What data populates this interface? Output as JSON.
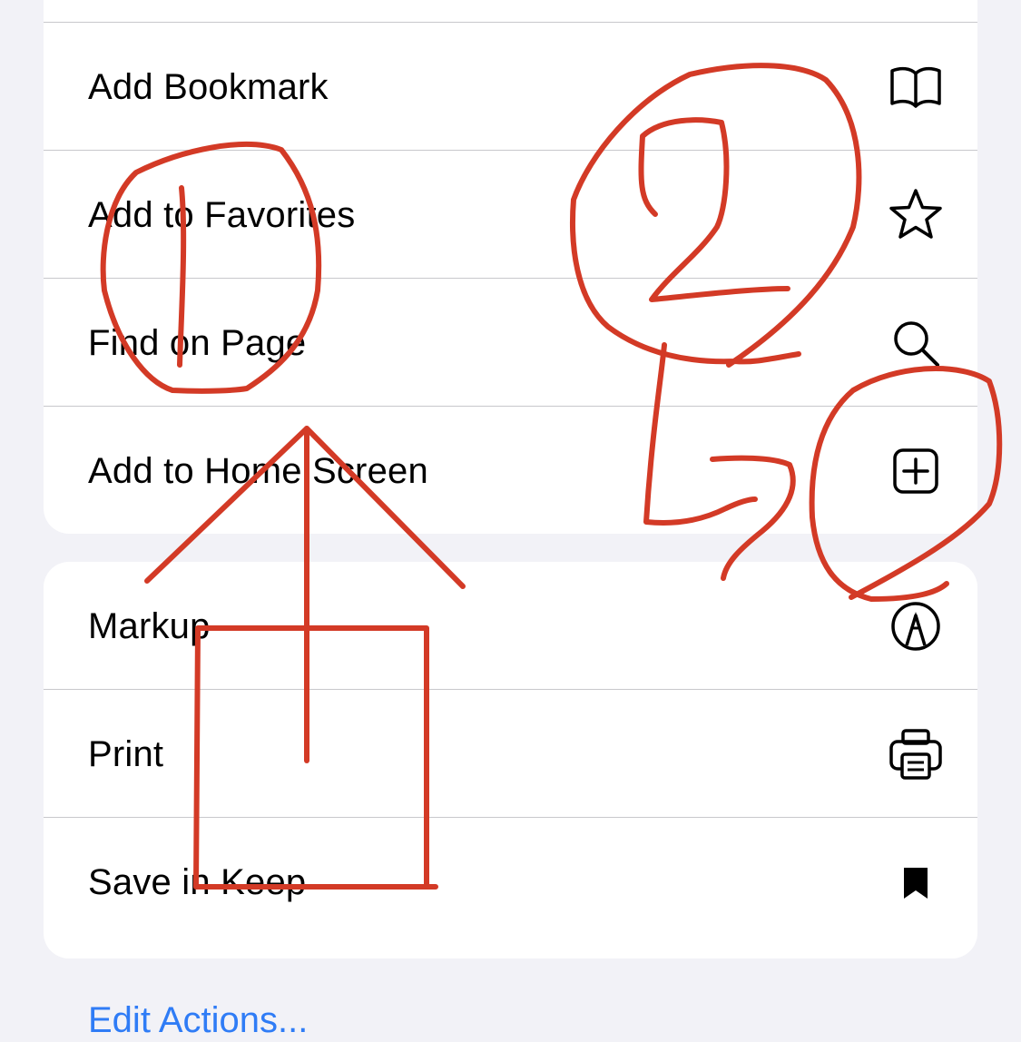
{
  "menu_group_1": {
    "items": [
      {
        "label": "Add Bookmark",
        "icon": "book-icon"
      },
      {
        "label": "Add to Favorites",
        "icon": "star-icon"
      },
      {
        "label": "Find on Page",
        "icon": "search-icon"
      },
      {
        "label": "Add to Home Screen",
        "icon": "add-square-icon"
      }
    ]
  },
  "menu_group_2": {
    "items": [
      {
        "label": "Markup",
        "icon": "markup-pen-icon"
      },
      {
        "label": "Print",
        "icon": "printer-icon"
      },
      {
        "label": "Save in Keep",
        "icon": "bookmark-icon"
      }
    ]
  },
  "footer": {
    "edit_actions_label": "Edit Actions..."
  },
  "colors": {
    "background": "#f2f2f7",
    "card": "#ffffff",
    "link": "#2f7cf6",
    "annotation": "#d33a26"
  }
}
